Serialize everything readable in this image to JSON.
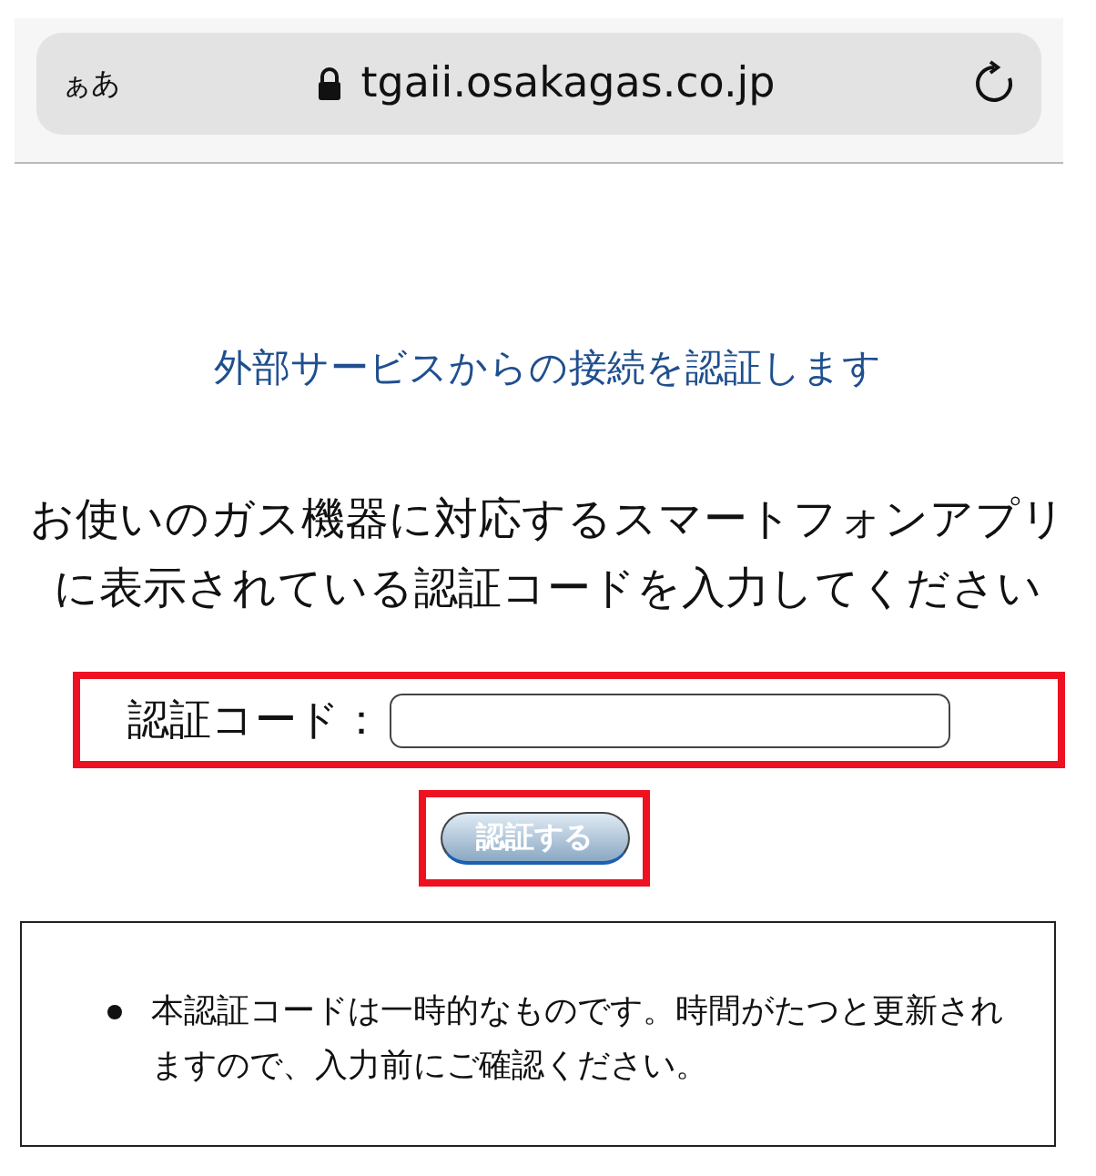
{
  "browser": {
    "text_size_button": "ぁあ",
    "url": "tgaii.osakagas.co.jp",
    "secure": true
  },
  "heading": "外部サービスからの接続を認証します",
  "instruction": "お使いのガス機器に対応するスマートフォンアプリに表示されている認証コードを入力してください",
  "code_field": {
    "label": "認証コード：",
    "highlighted": true
  },
  "submit_button": {
    "label": "認証する",
    "highlighted": true
  },
  "notice": {
    "items": [
      "本認証コードは一時的なものです。時間がたつと更新されますので、入力前にご確認ください。"
    ]
  }
}
